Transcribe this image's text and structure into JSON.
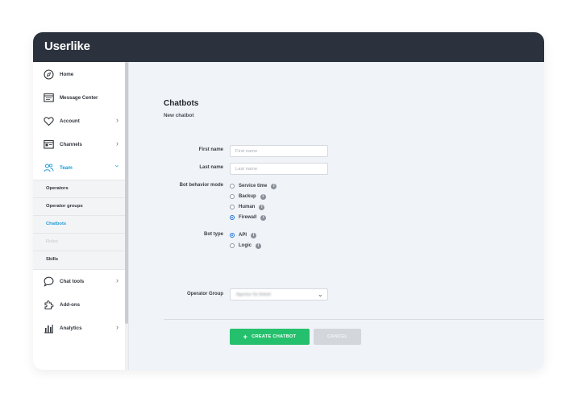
{
  "app": {
    "logo": "Userlike"
  },
  "sidebar": {
    "items": [
      {
        "label": "Home",
        "icon": "compass-icon",
        "has_chevron": false
      },
      {
        "label": "Message Center",
        "icon": "message-center-icon",
        "has_chevron": false
      },
      {
        "label": "Account",
        "icon": "heart-icon",
        "has_chevron": true
      },
      {
        "label": "Channels",
        "icon": "channels-icon",
        "has_chevron": true
      },
      {
        "label": "Team",
        "icon": "team-icon",
        "has_chevron": true,
        "expanded": true,
        "active": true
      }
    ],
    "team_subitems": [
      {
        "label": "Operators"
      },
      {
        "label": "Operator groups"
      },
      {
        "label": "Chatbots",
        "active": true
      },
      {
        "label": "Roles",
        "disabled": true
      },
      {
        "label": "Skills"
      }
    ],
    "bottom_items": [
      {
        "label": "Chat tools",
        "icon": "chat-bubble-icon",
        "has_chevron": true
      },
      {
        "label": "Add-ons",
        "icon": "puzzle-icon",
        "has_chevron": false
      },
      {
        "label": "Analytics",
        "icon": "bar-chart-icon",
        "has_chevron": true
      }
    ]
  },
  "page": {
    "title": "Chatbots",
    "subtitle": "New chatbot"
  },
  "form": {
    "first_name": {
      "label": "First name",
      "placeholder": "First name",
      "value": ""
    },
    "last_name": {
      "label": "Last name",
      "placeholder": "Last name",
      "value": ""
    },
    "bot_behavior": {
      "label": "Bot behavior mode",
      "options": [
        {
          "label": "Service time",
          "checked": false
        },
        {
          "label": "Backup",
          "checked": false
        },
        {
          "label": "Human",
          "checked": false
        },
        {
          "label": "Firewall",
          "checked": true
        }
      ]
    },
    "bot_type": {
      "label": "Bot type",
      "options": [
        {
          "label": "API",
          "checked": true
        },
        {
          "label": "Logic",
          "checked": false
        }
      ]
    },
    "operator_group": {
      "label": "Operator Group",
      "value": "Agentur für Arbeit"
    }
  },
  "actions": {
    "create_plus": "+",
    "create_label": "CREATE CHATBOT",
    "cancel_label": "CANCEL"
  },
  "colors": {
    "topbar": "#2b323d",
    "accent_blue": "#1d9bd8",
    "create_green": "#25c06d",
    "cancel_grey": "#d3d6db",
    "main_bg": "#f0f3f8"
  }
}
